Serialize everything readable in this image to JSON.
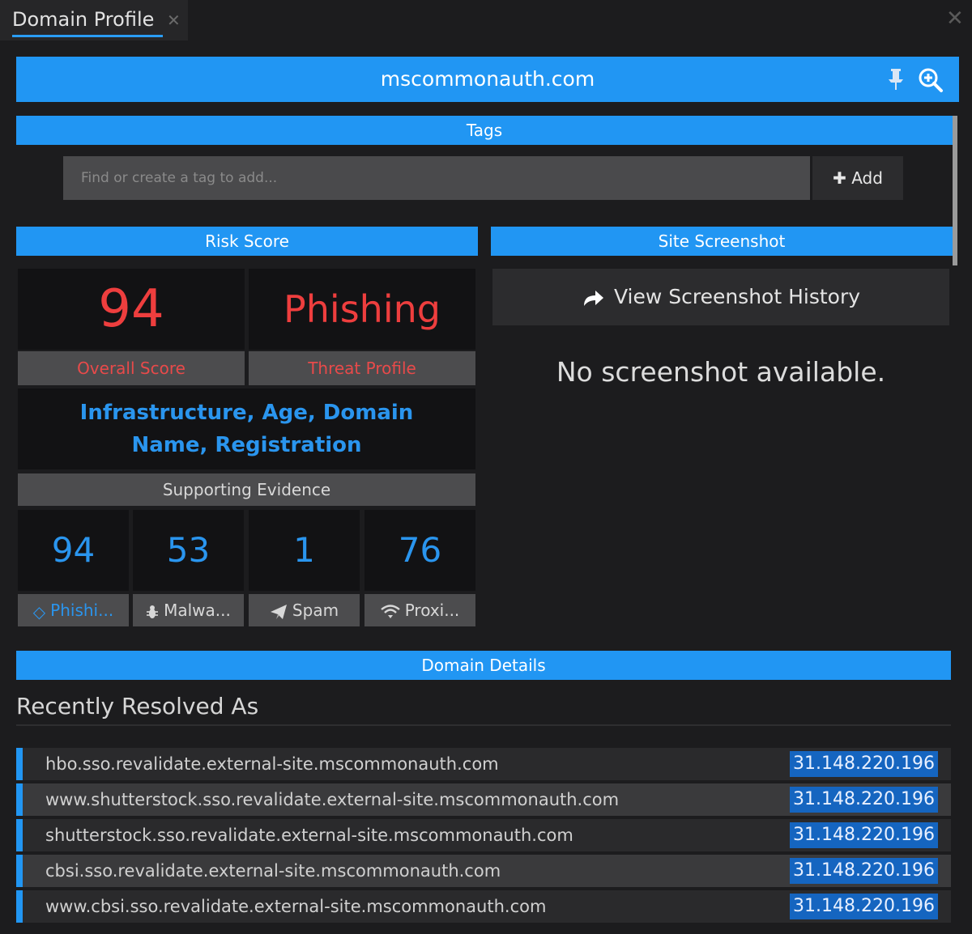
{
  "tab": {
    "title": "Domain Profile"
  },
  "domain": {
    "name": "mscommonauth.com"
  },
  "tags": {
    "header": "Tags",
    "placeholder": "Find or create a tag to add...",
    "add_label": "Add"
  },
  "risk": {
    "header": "Risk Score",
    "overall_score": "94",
    "overall_label": "Overall Score",
    "threat_profile": "Phishing",
    "threat_label": "Threat Profile",
    "factors": "Infrastructure, Age, Domain Name, Registration",
    "supporting_header": "Supporting Evidence",
    "evidence": [
      {
        "value": "94",
        "label": "Phishi...",
        "icon": "diamond-icon"
      },
      {
        "value": "53",
        "label": "Malwa...",
        "icon": "bug-icon"
      },
      {
        "value": "1",
        "label": "Spam",
        "icon": "send-icon"
      },
      {
        "value": "76",
        "label": "Proxi...",
        "icon": "wifi-icon"
      }
    ]
  },
  "screenshot": {
    "header": "Site Screenshot",
    "history_label": "View Screenshot History",
    "empty_message": "No screenshot available."
  },
  "details": {
    "header": "Domain Details",
    "resolved_title": "Recently Resolved As",
    "rows": [
      {
        "host": "hbo.sso.revalidate.external-site.mscommonauth.com",
        "ip": "31.148.220.196"
      },
      {
        "host": "www.shutterstock.sso.revalidate.external-site.mscommonauth.com",
        "ip": "31.148.220.196"
      },
      {
        "host": "shutterstock.sso.revalidate.external-site.mscommonauth.com",
        "ip": "31.148.220.196"
      },
      {
        "host": "cbsi.sso.revalidate.external-site.mscommonauth.com",
        "ip": "31.148.220.196"
      },
      {
        "host": "www.cbsi.sso.revalidate.external-site.mscommonauth.com",
        "ip": "31.148.220.196"
      }
    ]
  },
  "colors": {
    "accent": "#2196f3",
    "danger": "#ee3e3e",
    "background": "#1c1c1e"
  }
}
